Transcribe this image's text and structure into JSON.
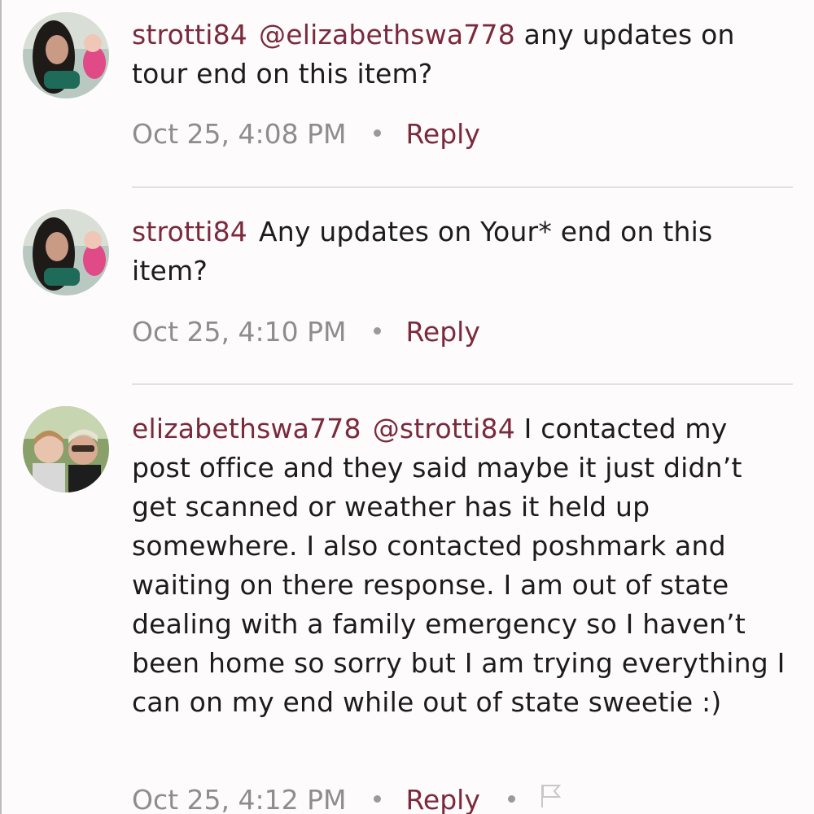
{
  "comments": [
    {
      "username": "strotti84",
      "mention": "@elizabethswa778",
      "text": " any updates on tour end on this item?",
      "timestamp": "Oct 25, 4:08 PM",
      "reply_label": "Reply"
    },
    {
      "username": "strotti84",
      "mention": "",
      "text": "Any updates on Your* end on this item?",
      "timestamp": "Oct 25, 4:10 PM",
      "reply_label": "Reply"
    },
    {
      "username": "elizabethswa778",
      "mention": "@strotti84",
      "text": " I contacted my post office and they said maybe it just didn’t get scanned or weather has it held up somewhere. I also contacted poshmark and waiting on there response. I am out of state dealing with a family emergency so I haven’t been home so sorry but I am trying everything I can on my end while out of state sweetie :)",
      "timestamp": "Oct 25, 4:12 PM",
      "reply_label": "Reply"
    }
  ],
  "colors": {
    "accent": "#7a2a3c",
    "timestamp": "#8d8d8d",
    "text": "#1c1c1c",
    "background": "#fdfbfc"
  },
  "icons": [
    "flag-icon"
  ]
}
